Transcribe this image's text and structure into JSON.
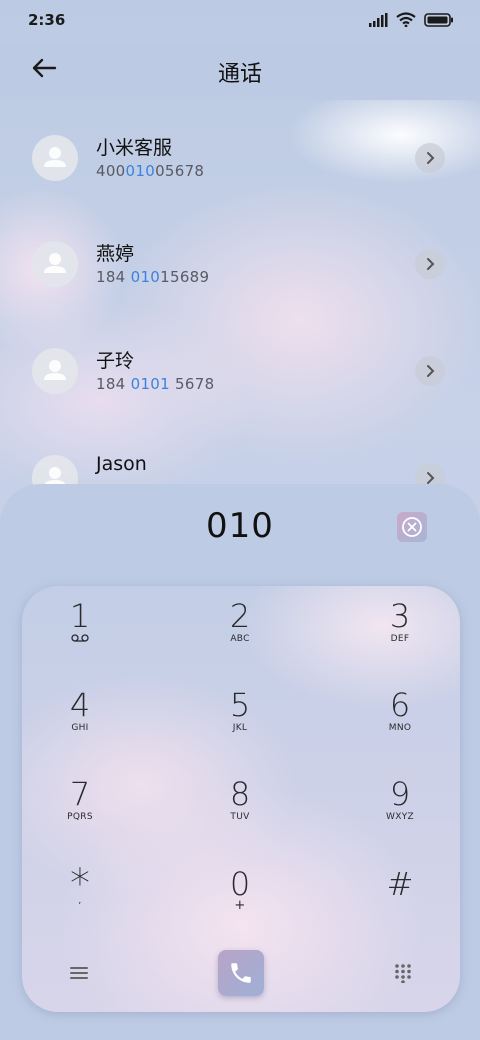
{
  "status_bar": {
    "time": "2:36"
  },
  "header": {
    "title": "通话"
  },
  "contacts": [
    {
      "name": "小米客服",
      "num_pre": "400",
      "num_hl": "010",
      "num_post": "05678"
    },
    {
      "name": "燕婷",
      "num_pre": "184 ",
      "num_hl": "010",
      "num_post": "15689"
    },
    {
      "name": "子玲",
      "num_pre": "184 ",
      "num_hl": "0101",
      "num_post": " 5678"
    },
    {
      "name": "Jason",
      "num_pre": "",
      "num_hl": "",
      "num_post": ""
    }
  ],
  "dialer": {
    "number": "010",
    "keys": [
      {
        "digit": "1",
        "letters": ""
      },
      {
        "digit": "2",
        "letters": "ABC"
      },
      {
        "digit": "3",
        "letters": "DEF"
      },
      {
        "digit": "4",
        "letters": "GHI"
      },
      {
        "digit": "5",
        "letters": "JKL"
      },
      {
        "digit": "6",
        "letters": "MNO"
      },
      {
        "digit": "7",
        "letters": "PQRS"
      },
      {
        "digit": "8",
        "letters": "TUV"
      },
      {
        "digit": "9",
        "letters": "WXYZ"
      },
      {
        "digit": "*",
        "letters": ","
      },
      {
        "digit": "0",
        "letters": "+"
      },
      {
        "digit": "#",
        "letters": ""
      }
    ],
    "icons": [
      "voicemail-icon",
      "backspace-icon",
      "menu-icon",
      "phone-icon",
      "keypad-icon"
    ]
  },
  "colors": {
    "highlight": "#3b82e0",
    "background": "#bccbe3"
  }
}
